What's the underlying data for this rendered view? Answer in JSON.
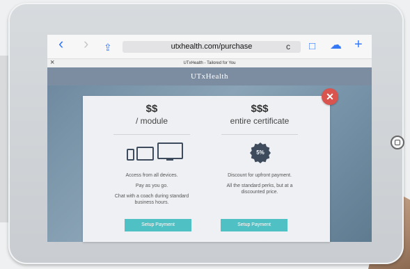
{
  "browser": {
    "url": "utxhealth.com/purchase",
    "tab_title": "UTxHealth - Tailored for You",
    "icons": {
      "back": "‹",
      "forward": "›",
      "share": "⇪",
      "reload": "c",
      "reader": "□",
      "cloud": "☁",
      "add": "+",
      "close_tab": "×"
    }
  },
  "site": {
    "title": "UTxHealth"
  },
  "modal": {
    "close": "✕",
    "plans": [
      {
        "price": "$$",
        "unit": "/ module",
        "features": [
          "Access from all devices.",
          "Pay as you go.",
          "Chat with a coach during standard business hours."
        ],
        "button": "Setup Payment"
      },
      {
        "price": "$$$",
        "unit": "entire certificate",
        "badge": "5%",
        "features": [
          "Discount for upfront payment.",
          "All the standard perks, but at a discounted price."
        ],
        "button": "Setup Payment"
      }
    ]
  },
  "colors": {
    "accent": "#4fc0c3",
    "header": "#7d8da1",
    "close": "#d9534f",
    "ios_blue": "#3478f6"
  }
}
